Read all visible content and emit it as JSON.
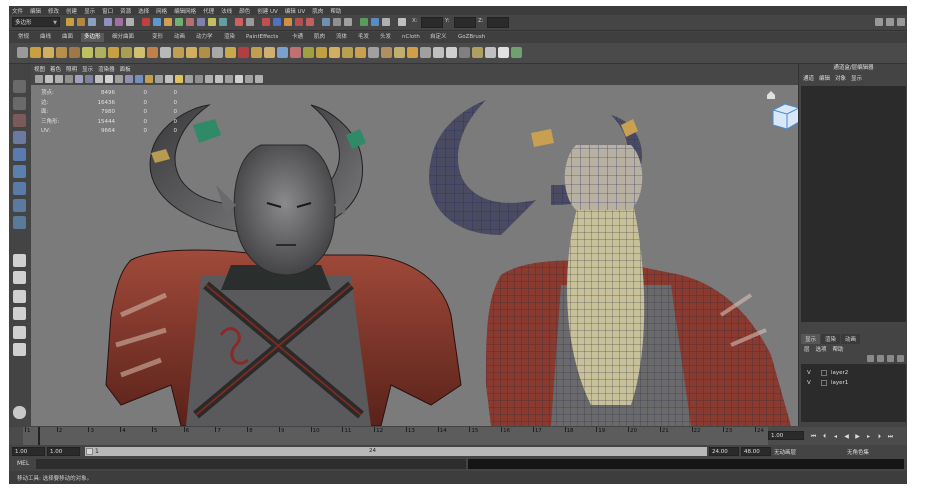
{
  "menu": [
    "文件",
    "编辑",
    "修改",
    "创建",
    "显示",
    "窗口",
    "资源",
    "选择",
    "网格",
    "编辑网格",
    "代理",
    "法线",
    "颜色",
    "创建 UV",
    "编辑 UV",
    "肌肉",
    "帮助"
  ],
  "status": {
    "mode": "多边形",
    "x_label": "X:",
    "y_label": "Y:",
    "z_label": "Z:"
  },
  "shelf_tabs": [
    "常规",
    "曲线",
    "曲面",
    "多边形",
    "细分曲面",
    "变形",
    "动画",
    "动力学",
    "渲染",
    "PaintEffects",
    "卡通",
    "肌肉",
    "流体",
    "毛发",
    "头发",
    "nCloth",
    "自定义",
    "GoZBrush"
  ],
  "shelf_active": "多边形",
  "viewport_menu": [
    "视图",
    "着色",
    "照明",
    "显示",
    "渲染器",
    "面板"
  ],
  "hud": [
    {
      "label": "顶点:",
      "a": "8496",
      "b": "0",
      "c": "0"
    },
    {
      "label": "边:",
      "a": "16436",
      "b": "0",
      "c": "0"
    },
    {
      "label": "面:",
      "a": "7980",
      "b": "0",
      "c": "0"
    },
    {
      "label": "三角形:",
      "a": "15444",
      "b": "0",
      "c": "0"
    },
    {
      "label": "UV:",
      "a": "9664",
      "b": "0",
      "c": "0"
    }
  ],
  "channel_box": {
    "title": "通道盒/层编辑器",
    "menu": [
      "通道",
      "编辑",
      "对象",
      "显示"
    ]
  },
  "layer_editor": {
    "tabs": [
      "显示",
      "渲染",
      "动画"
    ],
    "menu": [
      "层",
      "选项",
      "帮助"
    ],
    "layers": [
      {
        "visible": "V",
        "name": "layer2"
      },
      {
        "visible": "V",
        "name": "layer1"
      }
    ]
  },
  "timeline": {
    "ticks": [
      "1",
      "2",
      "3",
      "4",
      "5",
      "6",
      "7",
      "8",
      "9",
      "10",
      "11",
      "12",
      "13",
      "14",
      "15",
      "16",
      "17",
      "18",
      "19",
      "20",
      "21",
      "22",
      "23",
      "24"
    ],
    "current_frame": "1.00",
    "start": "1.00",
    "range_start": "1.00",
    "range_handle": "1",
    "range_mid": "24",
    "range_end": "24.00",
    "end": "48.00",
    "anim_layer": "无动画层",
    "char_set": "无角色集"
  },
  "mel": {
    "label": "MEL"
  },
  "help_line": "移动工具: 选择要移动的对象。"
}
